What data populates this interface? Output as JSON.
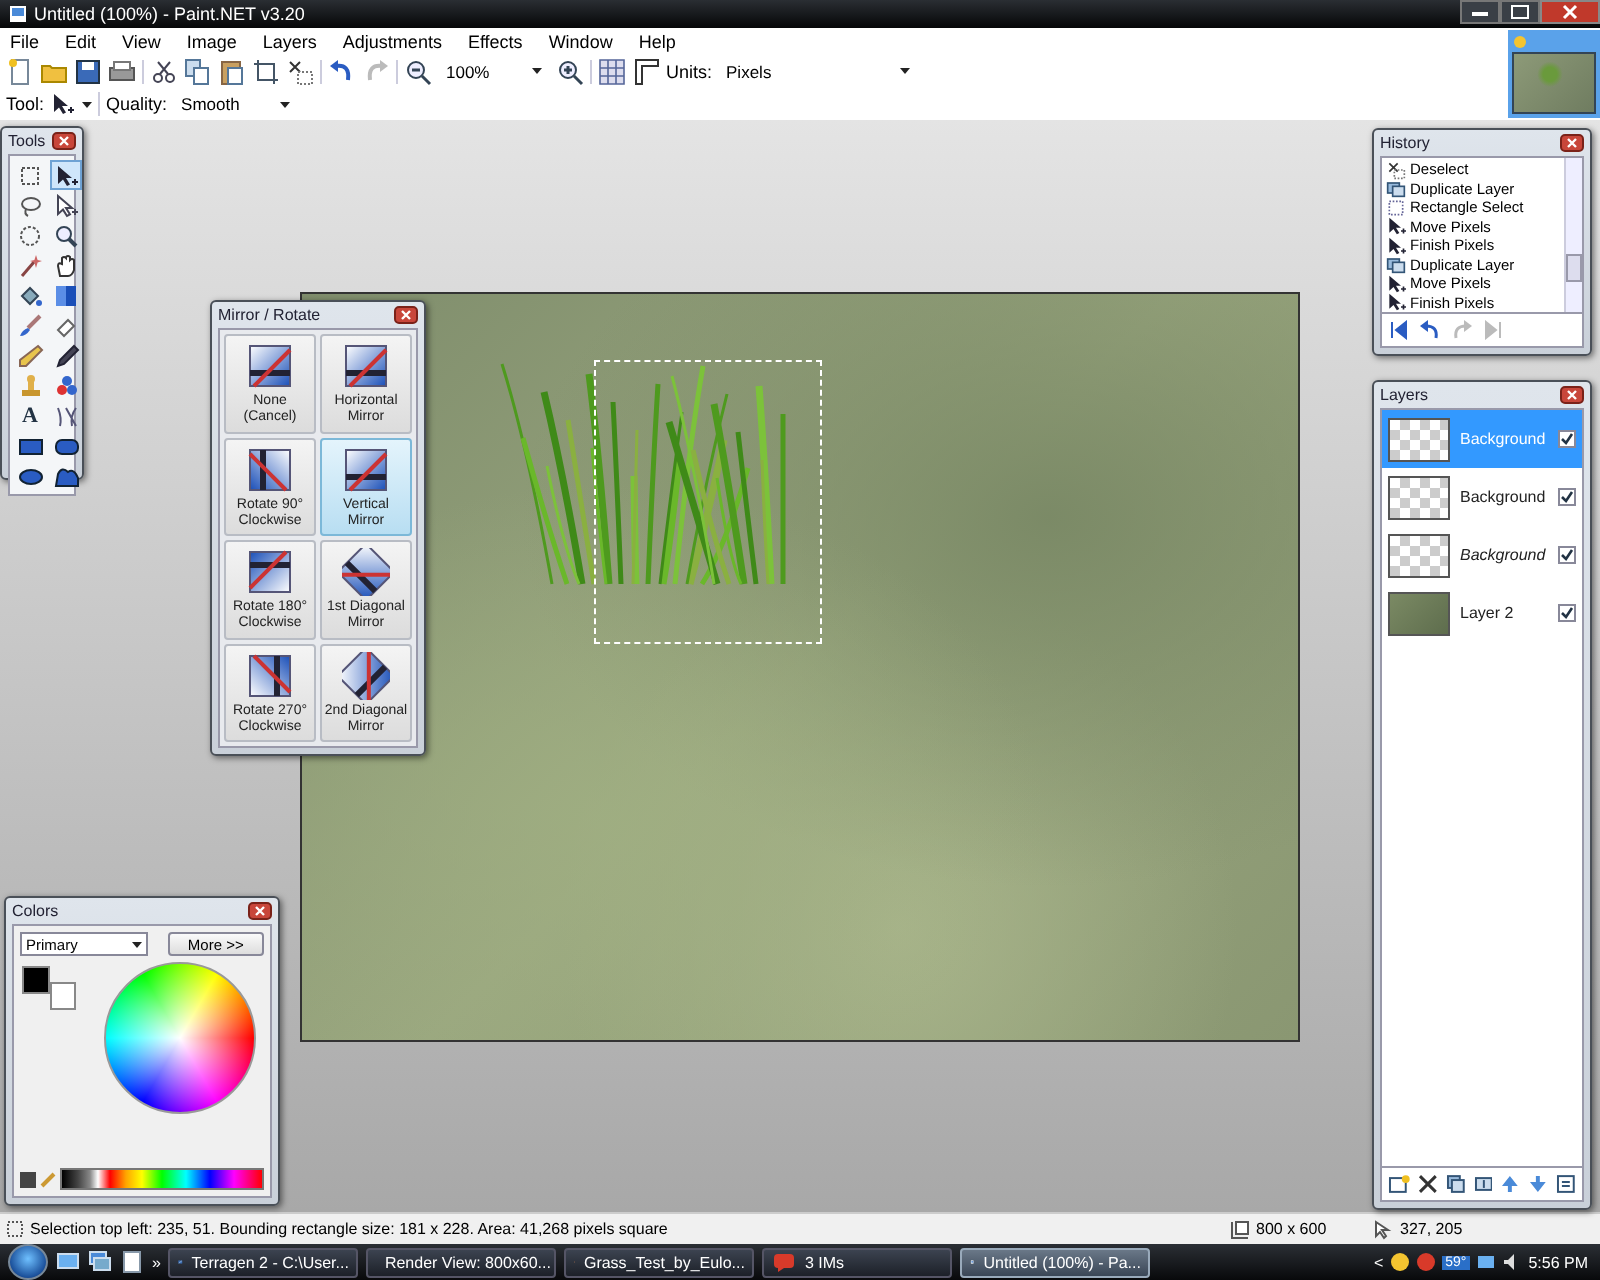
{
  "window": {
    "title": "Untitled (100%) - Paint.NET v3.20"
  },
  "menu": [
    "File",
    "Edit",
    "View",
    "Image",
    "Layers",
    "Adjustments",
    "Effects",
    "Window",
    "Help"
  ],
  "toolbar": {
    "zoom": "100%",
    "units_label": "Units:",
    "units": "Pixels"
  },
  "tool_bar": {
    "tool_label": "Tool:",
    "quality_label": "Quality:",
    "quality": "Smooth"
  },
  "tools_window": {
    "title": "Tools",
    "tools": [
      {
        "kind": "rect-select",
        "selected": false
      },
      {
        "kind": "move-pixels",
        "selected": true
      },
      {
        "kind": "lasso",
        "selected": false
      },
      {
        "kind": "move-selection",
        "selected": false
      },
      {
        "kind": "ellipse-select",
        "selected": false
      },
      {
        "kind": "zoom",
        "selected": false
      },
      {
        "kind": "magic-wand",
        "selected": false
      },
      {
        "kind": "pan",
        "selected": false
      },
      {
        "kind": "paint-bucket",
        "selected": false
      },
      {
        "kind": "gradient",
        "selected": false
      },
      {
        "kind": "paintbrush",
        "selected": false
      },
      {
        "kind": "eraser",
        "selected": false
      },
      {
        "kind": "pencil",
        "selected": false
      },
      {
        "kind": "color-picker",
        "selected": false
      },
      {
        "kind": "clone-stamp",
        "selected": false
      },
      {
        "kind": "recolor",
        "selected": false
      },
      {
        "kind": "text",
        "glyph": "A",
        "selected": false
      },
      {
        "kind": "line",
        "selected": false
      },
      {
        "kind": "rectangle",
        "selected": false
      },
      {
        "kind": "rounded-rectangle",
        "selected": false
      },
      {
        "kind": "ellipse",
        "selected": false
      },
      {
        "kind": "freeform",
        "selected": false
      }
    ]
  },
  "mirror_rotate": {
    "title": "Mirror / Rotate",
    "options": [
      {
        "label": "None\n(Cancel)",
        "selected": false
      },
      {
        "label": "Horizontal\nMirror",
        "selected": false
      },
      {
        "label": "Rotate 90°\nClockwise",
        "selected": false
      },
      {
        "label": "Vertical\nMirror",
        "selected": true
      },
      {
        "label": "Rotate 180°\nClockwise",
        "selected": false
      },
      {
        "label": "1st Diagonal\nMirror",
        "selected": false
      },
      {
        "label": "Rotate 270°\nClockwise",
        "selected": false
      },
      {
        "label": "2nd Diagonal\nMirror",
        "selected": false
      }
    ]
  },
  "history": {
    "title": "History",
    "items": [
      {
        "label": "Deselect",
        "kind": "deselect"
      },
      {
        "label": "Duplicate Layer",
        "kind": "duplicate-layer"
      },
      {
        "label": "Rectangle Select",
        "kind": "rect-select"
      },
      {
        "label": "Move Pixels",
        "kind": "move-pixels"
      },
      {
        "label": "Finish Pixels",
        "kind": "move-pixels"
      },
      {
        "label": "Duplicate Layer",
        "kind": "duplicate-layer"
      },
      {
        "label": "Move Pixels",
        "kind": "move-pixels"
      },
      {
        "label": "Finish Pixels",
        "kind": "move-pixels"
      }
    ]
  },
  "layers": {
    "title": "Layers",
    "items": [
      {
        "name": "Background",
        "selected": true,
        "visible": true,
        "italic": false,
        "kind": "transparent"
      },
      {
        "name": "Background",
        "selected": false,
        "visible": true,
        "italic": false,
        "kind": "transparent"
      },
      {
        "name": "Background",
        "selected": false,
        "visible": true,
        "italic": true,
        "kind": "transparent"
      },
      {
        "name": "Layer 2",
        "selected": false,
        "visible": true,
        "italic": false,
        "kind": "image"
      }
    ]
  },
  "colors": {
    "title": "Colors",
    "mode": "Primary",
    "more": "More >>"
  },
  "status_bar": {
    "selection": "Selection top left: 235, 51. Bounding rectangle size: 181 x 228. Area: 41,268 pixels square",
    "size": "800 x 600",
    "cursor": "327, 205"
  },
  "taskbar": {
    "overflow": "»",
    "tasks": [
      {
        "label": "Terragen 2 - C:\\User...",
        "kind": "terragen",
        "selected": false
      },
      {
        "label": "Render View: 800x60...",
        "kind": "terragen",
        "selected": false
      },
      {
        "label": "Grass_Test_by_Eulo...",
        "kind": "browser",
        "selected": false
      },
      {
        "label": "3 IMs",
        "kind": "messenger",
        "selected": false
      },
      {
        "label": "Untitled (100%) - Pa...",
        "kind": "paint",
        "selected": true
      }
    ],
    "tray_arrow": "<",
    "temperature": "59°",
    "clock": "5:56 PM"
  }
}
